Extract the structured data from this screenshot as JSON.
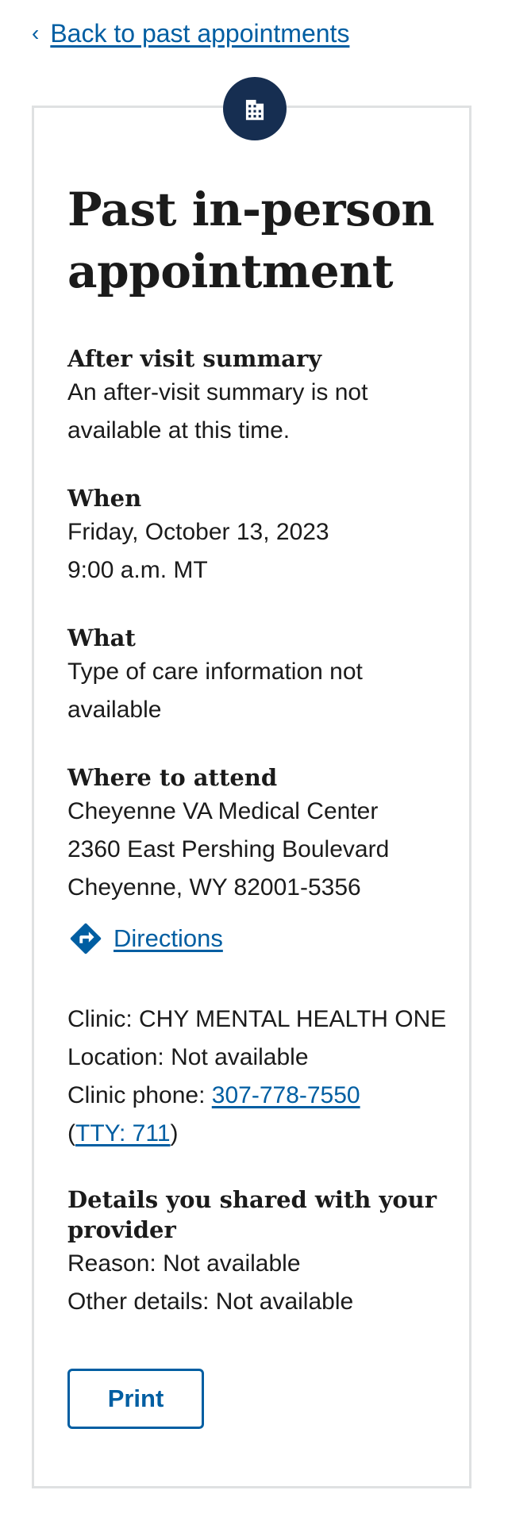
{
  "nav": {
    "back_label": "Back to past appointments",
    "back_chevron": "‹"
  },
  "header": {
    "icon": "building-icon",
    "title": "Past in-person appointment"
  },
  "after_visit": {
    "heading": "After visit summary",
    "text": "An after-visit summary is not available at this time."
  },
  "when": {
    "heading": "When",
    "date": "Friday, October 13, 2023",
    "time": "9:00 a.m. MT"
  },
  "what": {
    "heading": "What",
    "text": "Type of care information not available"
  },
  "where": {
    "heading": "Where to attend",
    "facility": "Cheyenne VA Medical Center",
    "street": "2360 East Pershing Boulevard",
    "city_state_zip": "Cheyenne, WY 82001-5356",
    "directions_label": "Directions",
    "directions_icon": "directions-icon"
  },
  "clinic": {
    "clinic_label": "Clinic: CHY MENTAL HEALTH ONE",
    "location_label": "Location: Not available",
    "phone_prefix": "Clinic phone: ",
    "phone": "307-778-7550",
    "tty_open": "(",
    "tty": "TTY: 711",
    "tty_close": ")"
  },
  "details": {
    "heading": "Details you shared with your provider",
    "reason": "Reason: Not available",
    "other": "Other details: Not available"
  },
  "actions": {
    "print_label": "Print"
  },
  "colors": {
    "link": "#005ea2",
    "badge": "#162e51",
    "border": "#dfe1e2",
    "text": "#1b1b1b"
  }
}
